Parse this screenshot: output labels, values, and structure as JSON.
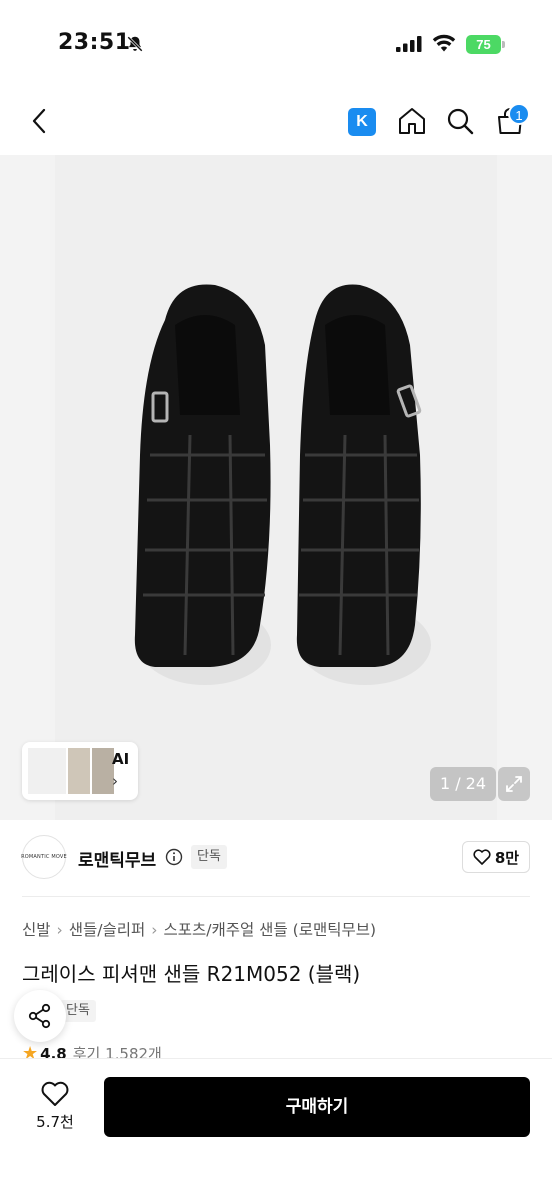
{
  "status_bar": {
    "time": "23:51",
    "battery": "75",
    "icons": [
      "bell-slash-icon",
      "signal-icon",
      "wifi-icon",
      "battery-icon"
    ]
  },
  "nav": {
    "icons": [
      "back-icon",
      "k-badge-icon",
      "home-icon",
      "search-icon",
      "cart-icon"
    ],
    "k_badge": "K",
    "cart_count": "1"
  },
  "gallery": {
    "ai_label": "AI",
    "ai_arrow": "›",
    "page_indicator": "1 / 24",
    "icons": [
      "expand-icon"
    ]
  },
  "brand": {
    "logo_text": "ROMANTIC MOVE",
    "name": "로맨틱무브",
    "exclusive_tag": "단독",
    "likes": "8만",
    "icons": [
      "info-icon",
      "heart-icon"
    ]
  },
  "breadcrumb": [
    "신발",
    "샌들/슬리퍼",
    "스포츠/캐주얼 샌들",
    "(로맨틱무브)"
  ],
  "product": {
    "title": "그레이스 피셔맨 샌들 R21M052 (블랙)",
    "exclusive_tag": "단독",
    "rating": "4.8",
    "reviews": "후기 1,582개"
  },
  "bottom_bar": {
    "wish_count": "5.7천",
    "buy_label": "구매하기",
    "icons": [
      "heart-icon",
      "share-icon"
    ]
  },
  "colors": {
    "accent": "#1a8cf0",
    "battery": "#4cd964",
    "star": "#f5a623",
    "buy_button": "#000000"
  }
}
